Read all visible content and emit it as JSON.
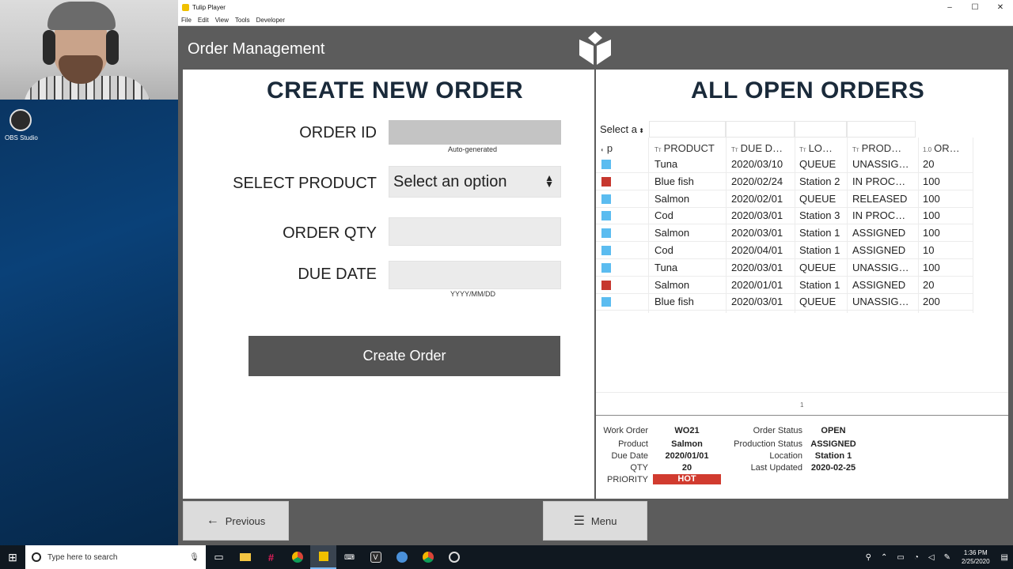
{
  "desktop": {
    "obs_label": "OBS Studio"
  },
  "window": {
    "title": "Tulip Player",
    "menu": [
      "File",
      "Edit",
      "View",
      "Tools",
      "Developer"
    ],
    "controls": [
      "–",
      "☐",
      "✕"
    ]
  },
  "app": {
    "title": "Order Management"
  },
  "create": {
    "title": "CREATE NEW ORDER",
    "order_id_label": "ORDER ID",
    "order_id_hint": "Auto-generated",
    "product_label": "SELECT PRODUCT",
    "product_value": "Select an option",
    "qty_label": "ORDER QTY",
    "due_label": "DUE DATE",
    "due_hint": "YYYY/MM/DD",
    "button": "Create Order"
  },
  "orders": {
    "title": "ALL OPEN ORDERS",
    "filter_select": "Select a",
    "columns": [
      {
        "icon": "◐",
        "label": "p"
      },
      {
        "icon": "Tт",
        "label": "PRODUCT"
      },
      {
        "icon": "Tт",
        "label": "DUE D…"
      },
      {
        "icon": "Tт",
        "label": "LO…"
      },
      {
        "icon": "Tт",
        "label": "PROD…"
      },
      {
        "icon": "1.0",
        "label": "OR…"
      }
    ],
    "rows": [
      {
        "color": "#5bbcf0",
        "product": "Tuna",
        "due": "2020/03/10",
        "loc": "QUEUE",
        "status": "UNASSIG…",
        "qty": "20"
      },
      {
        "color": "#c6372e",
        "product": "Blue fish",
        "due": "2020/02/24",
        "loc": "Station 2",
        "status": "IN PROC…",
        "qty": "100"
      },
      {
        "color": "#5bbcf0",
        "product": "Salmon",
        "due": "2020/02/01",
        "loc": "QUEUE",
        "status": "RELEASED",
        "qty": "100"
      },
      {
        "color": "#5bbcf0",
        "product": "Cod",
        "due": "2020/03/01",
        "loc": "Station 3",
        "status": "IN PROC…",
        "qty": "100"
      },
      {
        "color": "#5bbcf0",
        "product": "Salmon",
        "due": "2020/03/01",
        "loc": "Station 1",
        "status": "ASSIGNED",
        "qty": "100"
      },
      {
        "color": "#5bbcf0",
        "product": "Cod",
        "due": "2020/04/01",
        "loc": "Station 1",
        "status": "ASSIGNED",
        "qty": "10"
      },
      {
        "color": "#5bbcf0",
        "product": "Tuna",
        "due": "2020/03/01",
        "loc": "QUEUE",
        "status": "UNASSIG…",
        "qty": "100"
      },
      {
        "color": "#c6372e",
        "product": "Salmon",
        "due": "2020/01/01",
        "loc": "Station 1",
        "status": "ASSIGNED",
        "qty": "20"
      },
      {
        "color": "#5bbcf0",
        "product": "Blue fish",
        "due": "2020/03/01",
        "loc": "QUEUE",
        "status": "UNASSIG…",
        "qty": "200"
      }
    ],
    "page": "1"
  },
  "detail": {
    "work_order_label": "Work Order",
    "work_order": "WO21",
    "product_label": "Product",
    "product": "Salmon",
    "due_label": "Due Date",
    "due": "2020/01/01",
    "qty_label": "QTY",
    "qty": "20",
    "priority_label": "PRIORITY",
    "priority": "HOT",
    "order_status_label": "Order Status",
    "order_status": "OPEN",
    "prod_status_label": "Production Status",
    "prod_status": "ASSIGNED",
    "location_label": "Location",
    "location": "Station 1",
    "updated_label": "Last Updated",
    "updated": "2020-02-25"
  },
  "nav": {
    "previous": "Previous",
    "menu": "Menu"
  },
  "taskbar": {
    "search_placeholder": "Type here to search",
    "time": "1:36 PM",
    "date": "2/25/2020"
  }
}
